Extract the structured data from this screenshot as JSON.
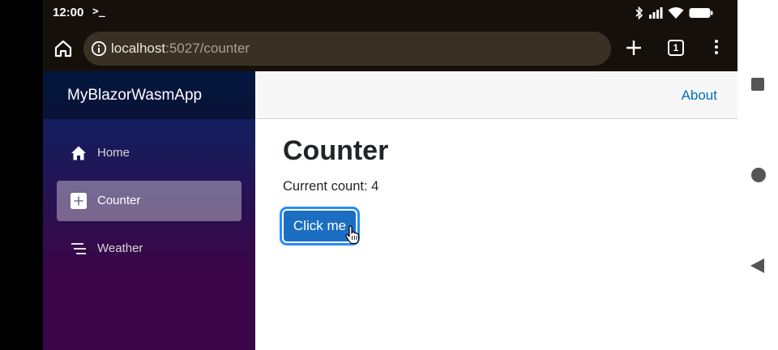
{
  "status_bar": {
    "time": "12:00",
    "terminal_glyph": ">_",
    "icons": [
      "bluetooth-icon",
      "signal-icon",
      "wifi-icon",
      "battery-icon"
    ]
  },
  "browser": {
    "url_host": "localhost",
    "url_path": ":5027/counter",
    "tab_count": "1",
    "icons": [
      "home-icon",
      "info-icon",
      "plus-icon",
      "tabs-icon",
      "more-vert-icon"
    ]
  },
  "sidebar": {
    "brand": "MyBlazorWasmApp",
    "items": [
      {
        "label": "Home",
        "icon": "home-icon",
        "active": false
      },
      {
        "label": "Counter",
        "icon": "plus-square-icon",
        "active": true
      },
      {
        "label": "Weather",
        "icon": "list-icon",
        "active": false
      }
    ]
  },
  "topbar": {
    "about_label": "About"
  },
  "main": {
    "title": "Counter",
    "count_text": "Current count: 4",
    "button_label": "Click me"
  },
  "colors": {
    "accent": "#1b6ec2",
    "link": "#0071c1",
    "browser_chrome": "#16100b",
    "url_pill": "#3a3124",
    "sidebar_top": "#052767",
    "sidebar_bottom": "#3a0647"
  }
}
